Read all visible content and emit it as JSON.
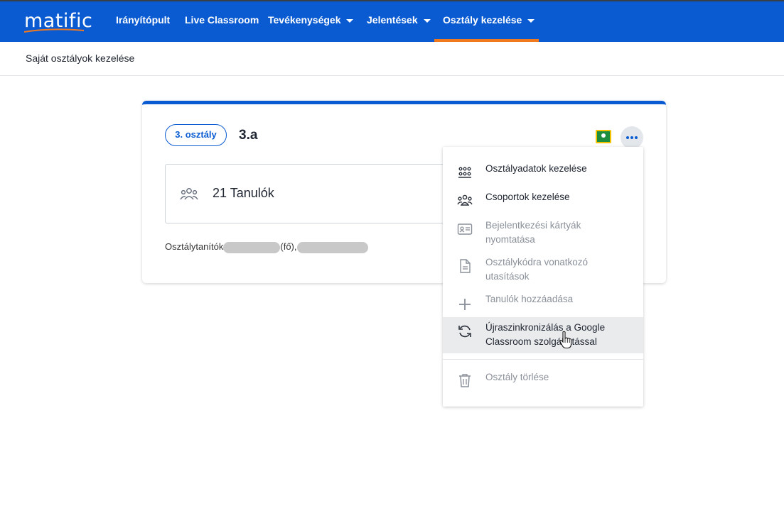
{
  "header": {
    "logo": "matific",
    "nav": [
      {
        "label": "Irányítópult",
        "dropdown": false
      },
      {
        "label": "Live Classroom",
        "dropdown": false
      },
      {
        "label": "Tevékenységek",
        "dropdown": true
      },
      {
        "label": "Jelentések",
        "dropdown": true
      },
      {
        "label": "Osztály kezelése",
        "dropdown": true,
        "active": true
      }
    ]
  },
  "subheader": {
    "title": "Saját osztályok kezelése"
  },
  "class_card": {
    "grade": "3. osztály",
    "name": "3.a",
    "students": "21 Tanulók",
    "teachers_label": "Osztálytanítók",
    "teacher_main_suffix": "(fő),"
  },
  "menu": {
    "items": [
      {
        "label": "Osztályadatok kezelése",
        "icon": "classroom-icon",
        "enabled": true
      },
      {
        "label": "Csoportok kezelése",
        "icon": "groups-icon",
        "enabled": true
      },
      {
        "label": "Bejelentkezési kártyák nyomtatása",
        "icon": "id-card-icon",
        "enabled": false
      },
      {
        "label": "Osztálykódra vonatkozó utasítások",
        "icon": "document-icon",
        "enabled": false
      },
      {
        "label": "Tanulók hozzáadása",
        "icon": "plus-icon",
        "enabled": false
      },
      {
        "label": "Újraszinkronizálás a Google Classroom szolgáltatással",
        "icon": "sync-icon",
        "enabled": true,
        "hovered": true
      },
      {
        "label": "Osztály törlése",
        "icon": "trash-icon",
        "enabled": false
      }
    ]
  },
  "colors": {
    "brand_blue": "#0a5bd2",
    "active_underline": "#f07a1d"
  }
}
